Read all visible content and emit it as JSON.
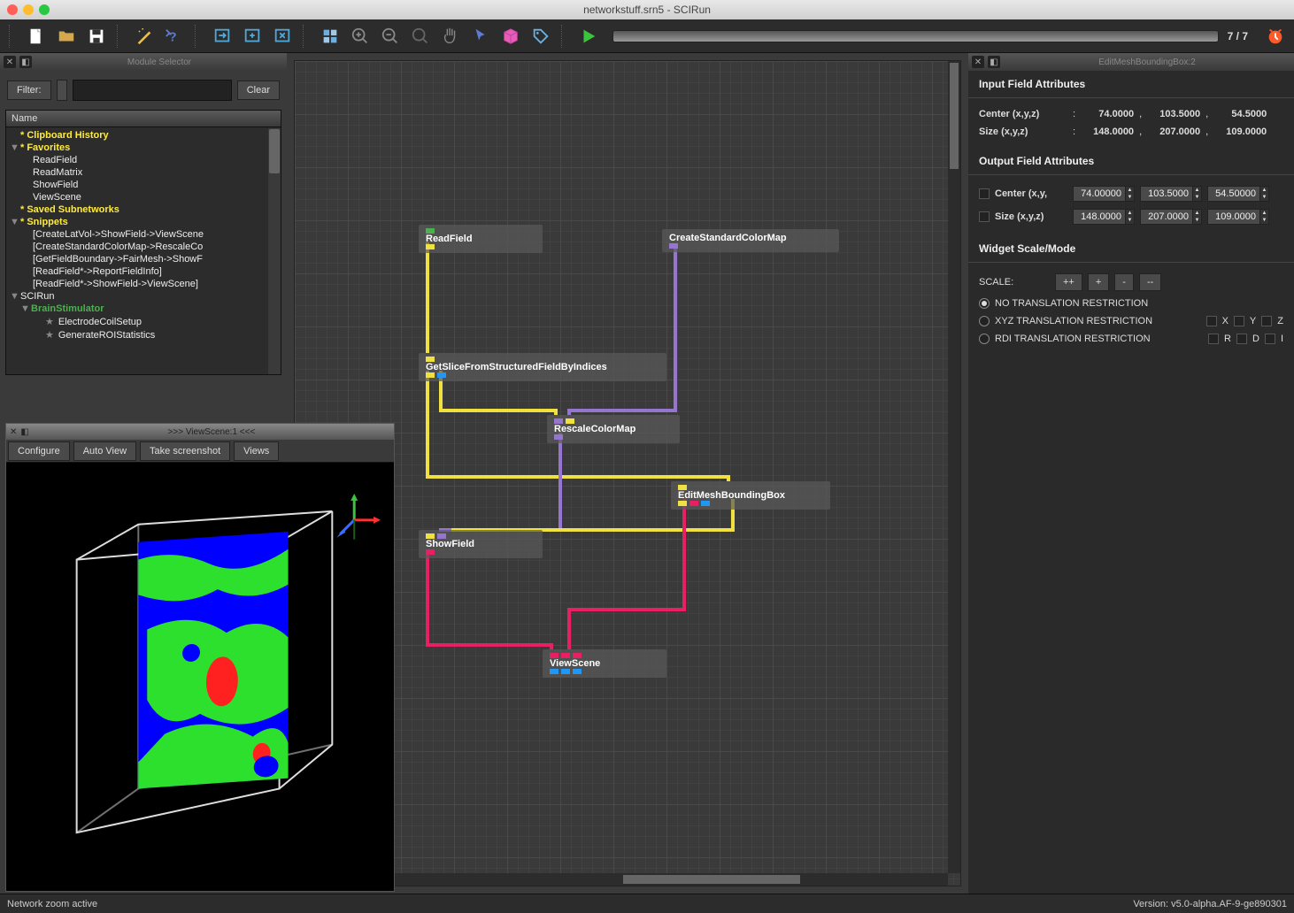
{
  "window": {
    "title": "networkstuff.srn5 - SCIRun"
  },
  "toolbar": {
    "progress": "7 / 7"
  },
  "moduleSelector": {
    "title": "Module Selector",
    "filterLabel": "Filter:",
    "clearLabel": "Clear",
    "treeHeader": "Name",
    "items": {
      "clipboard": "* Clipboard History",
      "favorites": "* Favorites",
      "fav0": "ReadField",
      "fav1": "ReadMatrix",
      "fav2": "ShowField",
      "fav3": "ViewScene",
      "saved": "* Saved Subnetworks",
      "snippets": "* Snippets",
      "snip0": "[CreateLatVol->ShowField->ViewScene",
      "snip1": "[CreateStandardColorMap->RescaleCo",
      "snip2": "[GetFieldBoundary->FairMesh->ShowF",
      "snip3": "[ReadField*->ReportFieldInfo]",
      "snip4": "[ReadField*->ShowField->ViewScene]",
      "scirun": "SCIRun",
      "brain": "BrainStimulator",
      "bs0": "ElectrodeCoilSetup",
      "bs1": "GenerateROIStatistics"
    }
  },
  "viewScene": {
    "title": ">>> ViewScene:1 <<<",
    "configure": "Configure",
    "autoView": "Auto View",
    "screenshot": "Take screenshot",
    "views": "Views"
  },
  "nodes": {
    "readField": "ReadField",
    "colorMap": "CreateStandardColorMap",
    "getSlice": "GetSliceFromStructuredFieldByIndices",
    "rescale": "RescaleColorMap",
    "editMesh": "EditMeshBoundingBox",
    "showField": "ShowField",
    "viewScene": "ViewScene"
  },
  "rightPanel": {
    "title": "EditMeshBoundingBox:2",
    "inputHeading": "Input Field Attributes",
    "outputHeading": "Output Field Attributes",
    "widgetHeading": "Widget Scale/Mode",
    "centerLabel": "Center (x,y,z)",
    "sizeLabel": "Size (x,y,z)",
    "centerShort": "Center (x,y,",
    "sizeShort": "Size (x,y,z)",
    "center": {
      "x": "74.0000",
      "y": "103.5000",
      "z": "54.5000"
    },
    "size": {
      "x": "148.0000",
      "y": "207.0000",
      "z": "109.0000"
    },
    "outCenter": {
      "x": "74.00000",
      "y": "103.5000",
      "z": "54.50000"
    },
    "outSize": {
      "x": "148.0000",
      "y": "207.0000",
      "z": "109.0000"
    },
    "scaleLabel": "SCALE:",
    "btnPP": "++",
    "btnP": "+",
    "btnM": "-",
    "btnMM": "--",
    "radioNo": "NO TRANSLATION RESTRICTION",
    "radioXYZ": "XYZ TRANSLATION RESTRICTION",
    "radioRDI": "RDI TRANSLATION RESTRICTION",
    "chkX": "X",
    "chkY": "Y",
    "chkZ": "Z",
    "chkR": "R",
    "chkD": "D",
    "chkI": "I"
  },
  "status": {
    "left": "Network zoom active",
    "right": "Version: v5.0-alpha.AF-9-ge890301"
  }
}
